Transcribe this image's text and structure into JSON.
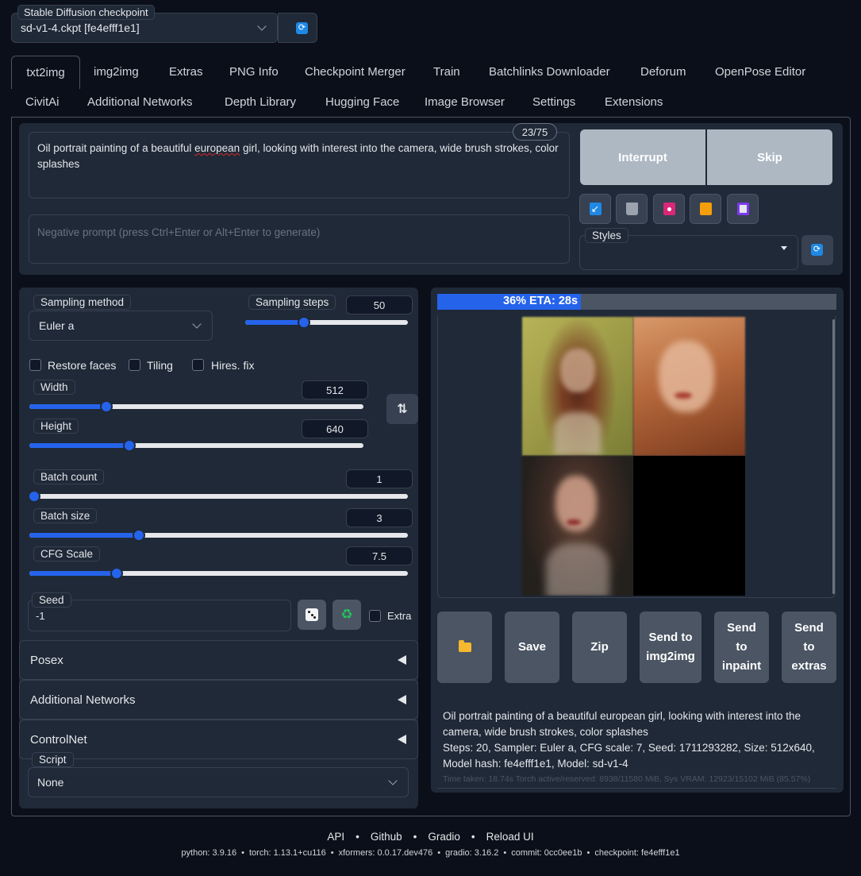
{
  "checkpoint": {
    "label": "Stable Diffusion checkpoint",
    "value": "sd-v1-4.ckpt [fe4efff1e1]"
  },
  "tabs_row1": [
    "txt2img",
    "img2img",
    "Extras",
    "PNG Info",
    "Checkpoint Merger",
    "Train",
    "Batchlinks Downloader",
    "Deforum",
    "OpenPose Editor"
  ],
  "tabs_row2": [
    "CivitAi",
    "Additional Networks",
    "Depth Library",
    "Hugging Face",
    "Image Browser",
    "Settings",
    "Extensions"
  ],
  "prompt": {
    "text_pre": "Oil portrait painting of a beautiful ",
    "text_misspelled": "european",
    "text_post": " girl, looking with interest into the camera, wide brush strokes, color splashes",
    "token_count": "23/75",
    "negative_placeholder": "Negative prompt (press Ctrl+Enter or Alt+Enter to generate)"
  },
  "actions": {
    "interrupt": "Interrupt",
    "skip": "Skip"
  },
  "styles": {
    "label": "Styles"
  },
  "sampling": {
    "method_label": "Sampling method",
    "method_value": "Euler a",
    "steps_label": "Sampling steps",
    "steps_value": "50",
    "steps_fraction": 0.36
  },
  "checkboxes": {
    "restore_faces": "Restore faces",
    "tiling": "Tiling",
    "hires_fix": "Hires. fix"
  },
  "width": {
    "label": "Width",
    "value": "512",
    "fraction": 0.23
  },
  "height": {
    "label": "Height",
    "value": "640",
    "fraction": 0.3
  },
  "batch_count": {
    "label": "Batch count",
    "value": "1",
    "fraction": 0.0
  },
  "batch_size": {
    "label": "Batch size",
    "value": "3",
    "fraction": 0.29
  },
  "cfg_scale": {
    "label": "CFG Scale",
    "value": "7.5",
    "fraction": 0.23
  },
  "seed": {
    "label": "Seed",
    "value": "-1",
    "extra_label": "Extra"
  },
  "accordions": {
    "posex": "Posex",
    "additional_networks": "Additional Networks",
    "controlnet": "ControlNet"
  },
  "script": {
    "label": "Script",
    "value": "None"
  },
  "progress": {
    "text": "36% ETA: 28s",
    "fraction": 0.36
  },
  "output_buttons": {
    "folder": "folder-icon",
    "save": "Save",
    "zip": "Zip",
    "send_img2img": "Send to img2img",
    "send_inpaint": "Send to inpaint",
    "send_extras": "Send to extras"
  },
  "generation_info": {
    "prompt": "Oil portrait painting of a beautiful european girl, looking with interest into the camera, wide brush strokes, color splashes",
    "params": "Steps: 20, Sampler: Euler a, CFG scale: 7, Seed: 1711293282, Size: 512x640, Model hash: fe4efff1e1, Model: sd-v1-4",
    "timing": "Time taken: 18.74s  Torch active/reserved: 8938/11580 MiB, Sys VRAM: 12923/15102 MiB (85.57%)"
  },
  "footer": {
    "links": [
      "API",
      "Github",
      "Gradio",
      "Reload UI"
    ],
    "versions": [
      "python: 3.9.16",
      "torch: 1.13.1+cu116",
      "xformers: 0.0.17.dev476",
      "gradio: 3.16.2",
      "commit: 0cc0ee1b",
      "checkpoint: fe4efff1e1"
    ]
  },
  "colors": {
    "background": "#0b0f19",
    "panel": "#1f2937",
    "accent_blue": "#2563eb",
    "button_gray": "#adb8c3"
  }
}
